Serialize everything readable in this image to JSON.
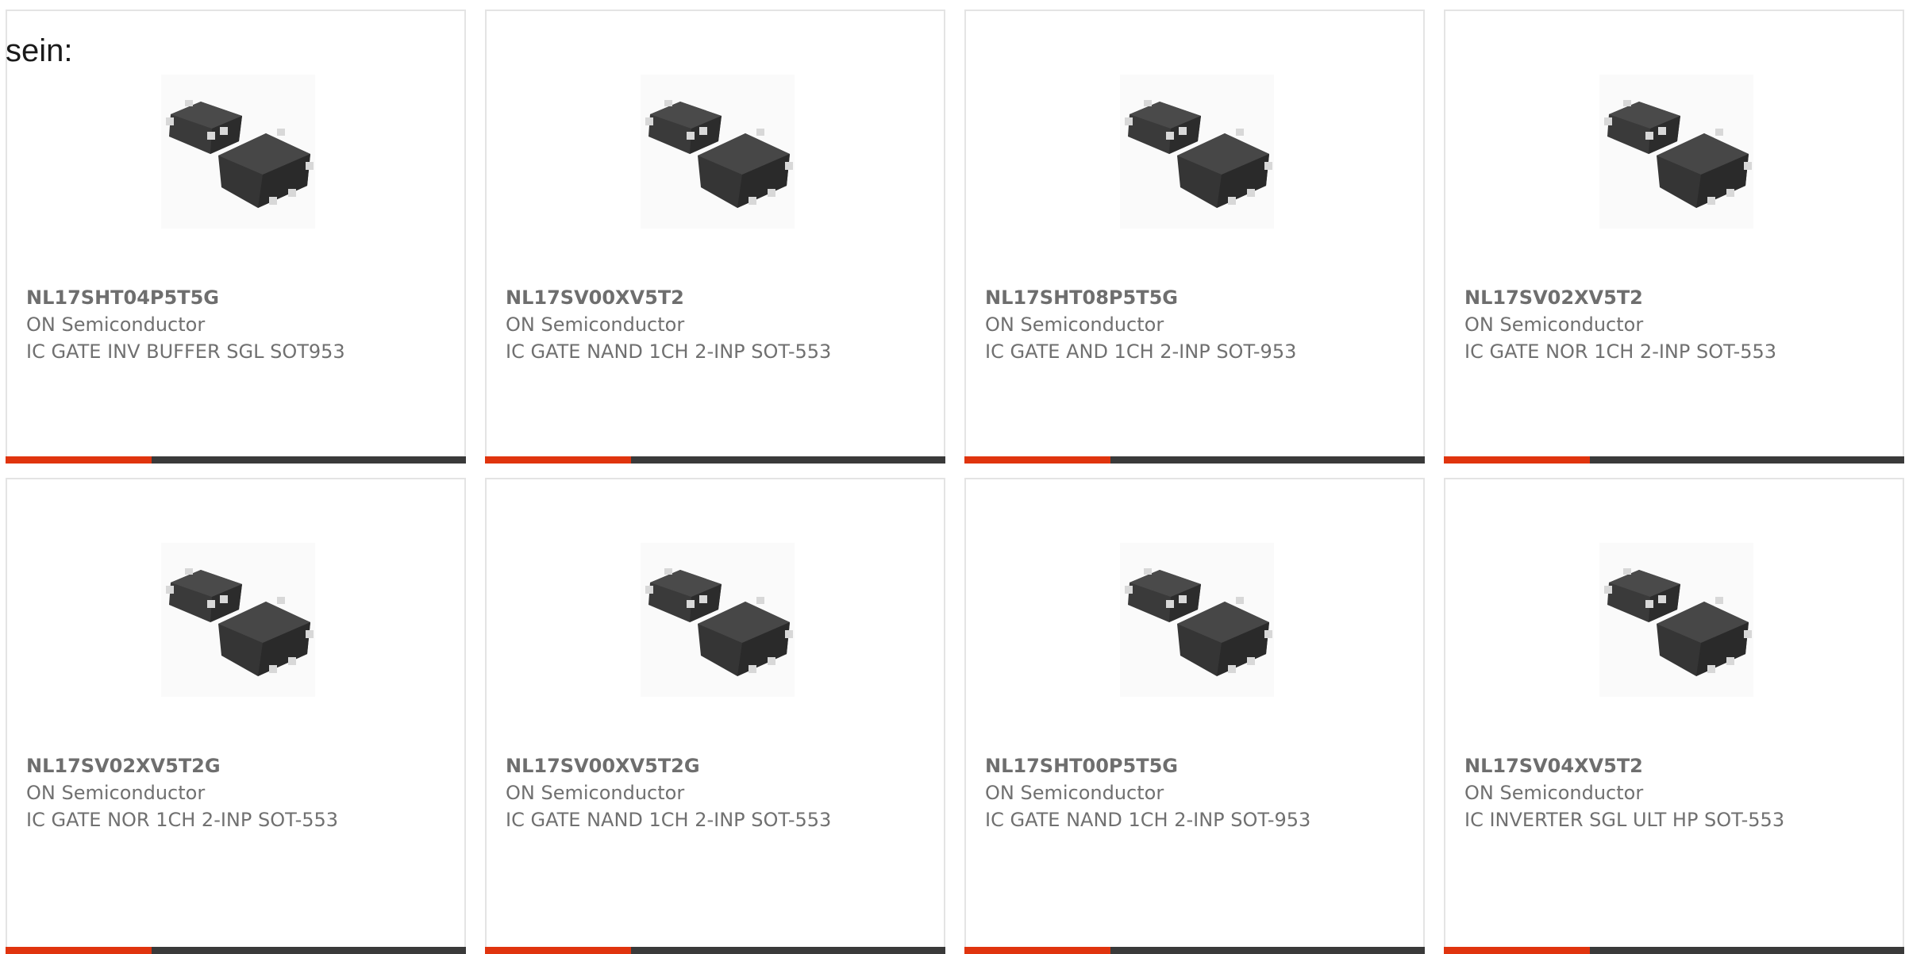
{
  "intro_text": "sein:",
  "products": [
    {
      "part": "NL17SHT04P5T5G",
      "manufacturer": "ON Semiconductor",
      "description": "IC GATE INV BUFFER SGL SOT953",
      "icon": "sot-553-package-image"
    },
    {
      "part": "NL17SV00XV5T2",
      "manufacturer": "ON Semiconductor",
      "description": "IC GATE NAND 1CH 2-INP SOT-553",
      "icon": "sot-553-package-image"
    },
    {
      "part": "NL17SHT08P5T5G",
      "manufacturer": "ON Semiconductor",
      "description": "IC GATE AND 1CH 2-INP SOT-953",
      "icon": "sot-553-package-image"
    },
    {
      "part": "NL17SV02XV5T2",
      "manufacturer": "ON Semiconductor",
      "description": "IC GATE NOR 1CH 2-INP SOT-553",
      "icon": "sot-553-package-image"
    },
    {
      "part": "NL17SV02XV5T2G",
      "manufacturer": "ON Semiconductor",
      "description": "IC GATE NOR 1CH 2-INP SOT-553",
      "icon": "sot-553-package-image"
    },
    {
      "part": "NL17SV00XV5T2G",
      "manufacturer": "ON Semiconductor",
      "description": "IC GATE NAND 1CH 2-INP SOT-553",
      "icon": "sot-553-package-image"
    },
    {
      "part": "NL17SHT00P5T5G",
      "manufacturer": "ON Semiconductor",
      "description": "IC GATE NAND 1CH 2-INP SOT-953",
      "icon": "sot-553-package-image"
    },
    {
      "part": "NL17SV04XV5T2",
      "manufacturer": "ON Semiconductor",
      "description": "IC INVERTER SGL ULT HP SOT-553",
      "icon": "sot-553-package-image"
    }
  ],
  "colors": {
    "accent": "#e0340e",
    "bar_dark": "#3a3a3a",
    "text": "#707070",
    "border": "#e4e4e4"
  }
}
